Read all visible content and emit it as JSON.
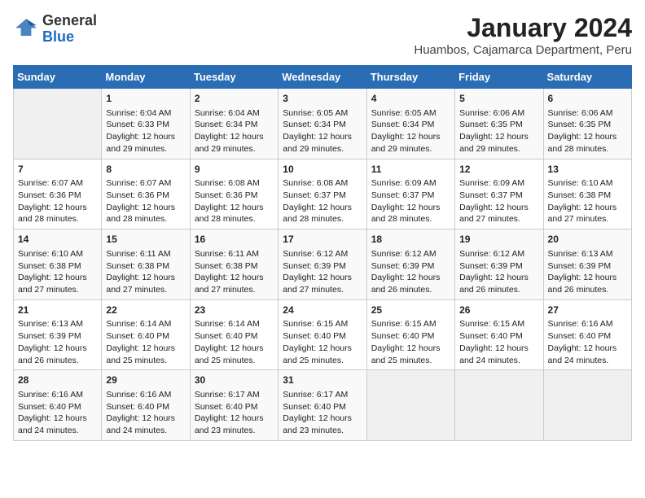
{
  "header": {
    "logo_line1": "General",
    "logo_line2": "Blue",
    "month_year": "January 2024",
    "location": "Huambos, Cajamarca Department, Peru"
  },
  "days_of_week": [
    "Sunday",
    "Monday",
    "Tuesday",
    "Wednesday",
    "Thursday",
    "Friday",
    "Saturday"
  ],
  "weeks": [
    [
      {
        "day": "",
        "info": ""
      },
      {
        "day": "1",
        "info": "Sunrise: 6:04 AM\nSunset: 6:33 PM\nDaylight: 12 hours\nand 29 minutes."
      },
      {
        "day": "2",
        "info": "Sunrise: 6:04 AM\nSunset: 6:34 PM\nDaylight: 12 hours\nand 29 minutes."
      },
      {
        "day": "3",
        "info": "Sunrise: 6:05 AM\nSunset: 6:34 PM\nDaylight: 12 hours\nand 29 minutes."
      },
      {
        "day": "4",
        "info": "Sunrise: 6:05 AM\nSunset: 6:34 PM\nDaylight: 12 hours\nand 29 minutes."
      },
      {
        "day": "5",
        "info": "Sunrise: 6:06 AM\nSunset: 6:35 PM\nDaylight: 12 hours\nand 29 minutes."
      },
      {
        "day": "6",
        "info": "Sunrise: 6:06 AM\nSunset: 6:35 PM\nDaylight: 12 hours\nand 28 minutes."
      }
    ],
    [
      {
        "day": "7",
        "info": "Sunrise: 6:07 AM\nSunset: 6:36 PM\nDaylight: 12 hours\nand 28 minutes."
      },
      {
        "day": "8",
        "info": "Sunrise: 6:07 AM\nSunset: 6:36 PM\nDaylight: 12 hours\nand 28 minutes."
      },
      {
        "day": "9",
        "info": "Sunrise: 6:08 AM\nSunset: 6:36 PM\nDaylight: 12 hours\nand 28 minutes."
      },
      {
        "day": "10",
        "info": "Sunrise: 6:08 AM\nSunset: 6:37 PM\nDaylight: 12 hours\nand 28 minutes."
      },
      {
        "day": "11",
        "info": "Sunrise: 6:09 AM\nSunset: 6:37 PM\nDaylight: 12 hours\nand 28 minutes."
      },
      {
        "day": "12",
        "info": "Sunrise: 6:09 AM\nSunset: 6:37 PM\nDaylight: 12 hours\nand 27 minutes."
      },
      {
        "day": "13",
        "info": "Sunrise: 6:10 AM\nSunset: 6:38 PM\nDaylight: 12 hours\nand 27 minutes."
      }
    ],
    [
      {
        "day": "14",
        "info": "Sunrise: 6:10 AM\nSunset: 6:38 PM\nDaylight: 12 hours\nand 27 minutes."
      },
      {
        "day": "15",
        "info": "Sunrise: 6:11 AM\nSunset: 6:38 PM\nDaylight: 12 hours\nand 27 minutes."
      },
      {
        "day": "16",
        "info": "Sunrise: 6:11 AM\nSunset: 6:38 PM\nDaylight: 12 hours\nand 27 minutes."
      },
      {
        "day": "17",
        "info": "Sunrise: 6:12 AM\nSunset: 6:39 PM\nDaylight: 12 hours\nand 27 minutes."
      },
      {
        "day": "18",
        "info": "Sunrise: 6:12 AM\nSunset: 6:39 PM\nDaylight: 12 hours\nand 26 minutes."
      },
      {
        "day": "19",
        "info": "Sunrise: 6:12 AM\nSunset: 6:39 PM\nDaylight: 12 hours\nand 26 minutes."
      },
      {
        "day": "20",
        "info": "Sunrise: 6:13 AM\nSunset: 6:39 PM\nDaylight: 12 hours\nand 26 minutes."
      }
    ],
    [
      {
        "day": "21",
        "info": "Sunrise: 6:13 AM\nSunset: 6:39 PM\nDaylight: 12 hours\nand 26 minutes."
      },
      {
        "day": "22",
        "info": "Sunrise: 6:14 AM\nSunset: 6:40 PM\nDaylight: 12 hours\nand 25 minutes."
      },
      {
        "day": "23",
        "info": "Sunrise: 6:14 AM\nSunset: 6:40 PM\nDaylight: 12 hours\nand 25 minutes."
      },
      {
        "day": "24",
        "info": "Sunrise: 6:15 AM\nSunset: 6:40 PM\nDaylight: 12 hours\nand 25 minutes."
      },
      {
        "day": "25",
        "info": "Sunrise: 6:15 AM\nSunset: 6:40 PM\nDaylight: 12 hours\nand 25 minutes."
      },
      {
        "day": "26",
        "info": "Sunrise: 6:15 AM\nSunset: 6:40 PM\nDaylight: 12 hours\nand 24 minutes."
      },
      {
        "day": "27",
        "info": "Sunrise: 6:16 AM\nSunset: 6:40 PM\nDaylight: 12 hours\nand 24 minutes."
      }
    ],
    [
      {
        "day": "28",
        "info": "Sunrise: 6:16 AM\nSunset: 6:40 PM\nDaylight: 12 hours\nand 24 minutes."
      },
      {
        "day": "29",
        "info": "Sunrise: 6:16 AM\nSunset: 6:40 PM\nDaylight: 12 hours\nand 24 minutes."
      },
      {
        "day": "30",
        "info": "Sunrise: 6:17 AM\nSunset: 6:40 PM\nDaylight: 12 hours\nand 23 minutes."
      },
      {
        "day": "31",
        "info": "Sunrise: 6:17 AM\nSunset: 6:40 PM\nDaylight: 12 hours\nand 23 minutes."
      },
      {
        "day": "",
        "info": ""
      },
      {
        "day": "",
        "info": ""
      },
      {
        "day": "",
        "info": ""
      }
    ]
  ]
}
